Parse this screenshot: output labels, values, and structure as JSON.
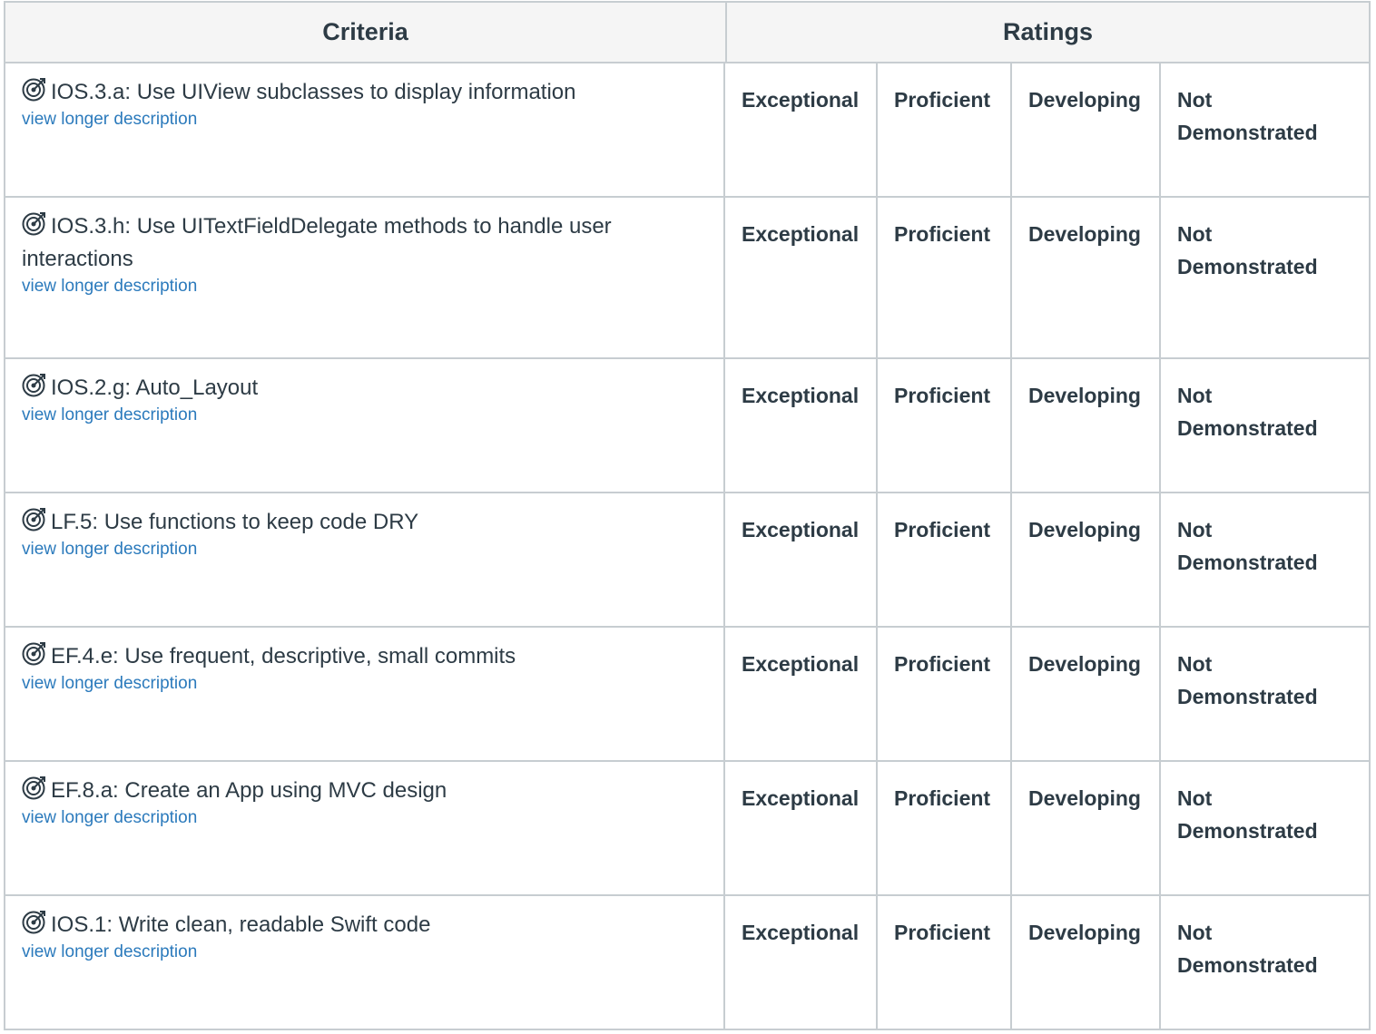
{
  "header": {
    "criteria_label": "Criteria",
    "ratings_label": "Ratings"
  },
  "rows": [
    {
      "title": "IOS.3.a: Use UIView subclasses to display information",
      "link": "view longer description",
      "ratings": [
        "Exceptional",
        "Proficient",
        "Developing",
        "Not Demonstrated"
      ]
    },
    {
      "title": "IOS.3.h: Use UITextFieldDelegate methods to handle user interactions",
      "link": "view longer description",
      "ratings": [
        "Exceptional",
        "Proficient",
        "Developing",
        "Not Demonstrated"
      ]
    },
    {
      "title": "IOS.2.g: Auto_Layout",
      "link": "view longer description",
      "ratings": [
        "Exceptional",
        "Proficient",
        "Developing",
        "Not Demonstrated"
      ]
    },
    {
      "title": "LF.5: Use functions to keep code DRY",
      "link": "view longer description",
      "ratings": [
        "Exceptional",
        "Proficient",
        "Developing",
        "Not Demonstrated"
      ]
    },
    {
      "title": "EF.4.e: Use frequent, descriptive, small commits",
      "link": "view longer description",
      "ratings": [
        "Exceptional",
        "Proficient",
        "Developing",
        "Not Demonstrated"
      ]
    },
    {
      "title": "EF.8.a: Create an App using MVC design",
      "link": "view longer description",
      "ratings": [
        "Exceptional",
        "Proficient",
        "Developing",
        "Not Demonstrated"
      ]
    },
    {
      "title": "IOS.1: Write clean, readable Swift code",
      "link": "view longer description",
      "ratings": [
        "Exceptional",
        "Proficient",
        "Developing",
        "Not Demonstrated"
      ]
    }
  ],
  "icons": {
    "outcome": "target-icon"
  },
  "colors": {
    "link": "#2b7abc",
    "border": "#c7cdd1",
    "header_bg": "#f5f5f5",
    "text": "#2d3b45"
  }
}
